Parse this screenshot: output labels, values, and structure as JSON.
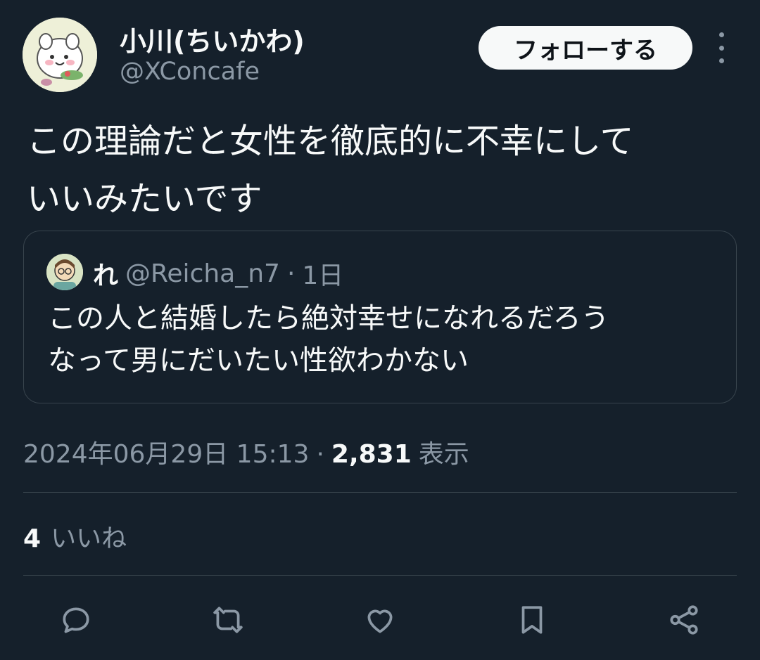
{
  "author": {
    "display_name": "小川(ちいかわ)",
    "handle": "@XConcafe",
    "follow_label": "フォローする"
  },
  "tweet": {
    "text_line1": "この理論だと女性を徹底的に不幸にして",
    "text_line2": "いいみたいです"
  },
  "quote": {
    "name": "れ",
    "handle": "@Reicha_n7",
    "separator": "·",
    "time": "1日",
    "text_line1": "この人と結婚したら絶対幸せになれるだろう",
    "text_line2": "なって男にだいたい性欲わかない"
  },
  "meta": {
    "datetime": "2024年06月29日 15:13",
    "separator": "·",
    "views_count": "2,831",
    "views_label": "表示"
  },
  "likes": {
    "count": "4",
    "label": "いいね"
  },
  "actions": {
    "icons": [
      "reply-icon",
      "retweet-icon",
      "like-icon",
      "bookmark-icon",
      "share-icon"
    ]
  },
  "colors": {
    "background": "#15202b",
    "text_primary": "#f7f9f9",
    "text_secondary": "#8b98a5",
    "border": "#38444d"
  }
}
